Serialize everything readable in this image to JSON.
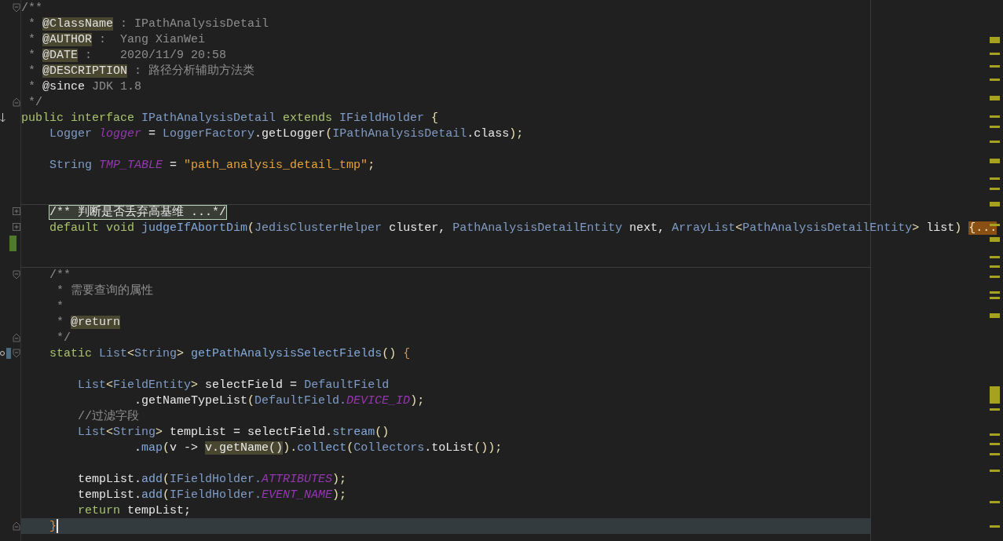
{
  "editor": {
    "lines": [
      {
        "gutter": [
          {
            "kind": "foldstart"
          }
        ],
        "tokens": [
          {
            "t": "/**",
            "kind": "comment"
          }
        ]
      },
      {
        "tokens": [
          {
            "t": " * ",
            "kind": "comment"
          },
          {
            "t": "@ClassName",
            "kind": "tag"
          },
          {
            "t": " : IPathAnalysisDetail",
            "kind": "comment"
          }
        ]
      },
      {
        "tokens": [
          {
            "t": " * ",
            "kind": "comment"
          },
          {
            "t": "@AUTHOR",
            "kind": "tag"
          },
          {
            "t": " :  Yang XianWei",
            "kind": "comment"
          }
        ]
      },
      {
        "tokens": [
          {
            "t": " * ",
            "kind": "comment"
          },
          {
            "t": "@DATE",
            "kind": "tag"
          },
          {
            "t": " :    2020/11/9 20:58",
            "kind": "comment"
          }
        ]
      },
      {
        "tokens": [
          {
            "t": " * ",
            "kind": "comment"
          },
          {
            "t": "@DESCRIPTION",
            "kind": "tag"
          },
          {
            "t": " : 路径分析辅助方法类",
            "kind": "comment"
          }
        ]
      },
      {
        "tokens": [
          {
            "t": " * ",
            "kind": "comment"
          },
          {
            "t": "@since",
            "kind": "doctag"
          },
          {
            "t": " JDK 1.8",
            "kind": "comment"
          }
        ]
      },
      {
        "gutter": [
          {
            "kind": "foldend"
          }
        ],
        "tokens": [
          {
            "t": " */",
            "kind": "comment"
          }
        ]
      },
      {
        "gutter": [
          {
            "kind": "implemented"
          }
        ],
        "tokens": [
          {
            "t": "public interface ",
            "kind": "keyword"
          },
          {
            "t": "IPathAnalysisDetail ",
            "kind": "type"
          },
          {
            "t": "extends ",
            "kind": "keyword"
          },
          {
            "t": "IFieldHolder ",
            "kind": "type"
          },
          {
            "t": "{",
            "kind": "punct"
          }
        ]
      },
      {
        "tokens": [
          {
            "t": "    Logger ",
            "kind": "type"
          },
          {
            "t": "logger",
            "kind": "field"
          },
          {
            "t": " = ",
            "kind": "plain"
          },
          {
            "t": "LoggerFactory",
            "kind": "type"
          },
          {
            "t": ".getLogger",
            "kind": "plain"
          },
          {
            "t": "(",
            "kind": "punct"
          },
          {
            "t": "IPathAnalysisDetail",
            "kind": "type"
          },
          {
            "t": ".class",
            "kind": "plain"
          },
          {
            "t": ");",
            "kind": "punct"
          }
        ]
      },
      {
        "kind": "blank"
      },
      {
        "tokens": [
          {
            "t": "    String ",
            "kind": "type"
          },
          {
            "t": "TMP_TABLE",
            "kind": "field"
          },
          {
            "t": " = ",
            "kind": "plain"
          },
          {
            "t": "\"path_analysis_detail_tmp\"",
            "kind": "string"
          },
          {
            "t": ";",
            "kind": "punct"
          }
        ]
      },
      {
        "kind": "blank"
      },
      {
        "kind": "blank"
      },
      {
        "separator": true,
        "gutter": [
          {
            "kind": "collapsed"
          }
        ],
        "tokens": [
          {
            "t": "    /** 判断是否丢弃高基维 ...*/",
            "kind": "foldedcomment"
          }
        ]
      },
      {
        "gutter": [
          {
            "kind": "collapsed"
          }
        ],
        "tokens": [
          {
            "t": "    default void ",
            "kind": "keyword"
          },
          {
            "t": "judgeIfAbortDim",
            "kind": "method"
          },
          {
            "t": "(",
            "kind": "punct"
          },
          {
            "t": "JedisClusterHelper ",
            "kind": "type"
          },
          {
            "t": "cluster, ",
            "kind": "plain"
          },
          {
            "t": "PathAnalysisDetailEntity ",
            "kind": "type"
          },
          {
            "t": "next, ",
            "kind": "plain"
          },
          {
            "t": "ArrayList",
            "kind": "type"
          },
          {
            "t": "<",
            "kind": "punct"
          },
          {
            "t": "PathAnalysisDetailEntity",
            "kind": "type"
          },
          {
            "t": ">",
            "kind": "punct"
          },
          {
            "t": " list",
            "kind": "plain"
          },
          {
            "t": ") ",
            "kind": "punct"
          },
          {
            "t": "{...",
            "kind": "foldedcode"
          }
        ]
      },
      {
        "changed": true
      },
      {
        "kind": "blank"
      },
      {
        "separator": true,
        "gutter": [
          {
            "kind": "foldstart"
          }
        ],
        "tokens": [
          {
            "t": "    /**",
            "kind": "comment"
          }
        ]
      },
      {
        "tokens": [
          {
            "t": "     * 需要查询的属性",
            "kind": "comment"
          }
        ]
      },
      {
        "tokens": [
          {
            "t": "     *",
            "kind": "comment"
          }
        ]
      },
      {
        "tokens": [
          {
            "t": "     * ",
            "kind": "comment"
          },
          {
            "t": "@return",
            "kind": "tag"
          }
        ]
      },
      {
        "gutter": [
          {
            "kind": "foldend"
          }
        ],
        "tokens": [
          {
            "t": "     */",
            "kind": "comment"
          }
        ]
      },
      {
        "gutter": [
          {
            "kind": "overridden"
          },
          {
            "kind": "foldstart"
          }
        ],
        "tokens": [
          {
            "t": "    static ",
            "kind": "keyword"
          },
          {
            "t": "List",
            "kind": "type"
          },
          {
            "t": "<",
            "kind": "punct"
          },
          {
            "t": "String",
            "kind": "type"
          },
          {
            "t": "> ",
            "kind": "punct"
          },
          {
            "t": "getPathAnalysisSelectFields",
            "kind": "method"
          },
          {
            "t": "() ",
            "kind": "punct"
          },
          {
            "t": "{",
            "kind": "brace"
          }
        ]
      },
      {
        "kind": "blank"
      },
      {
        "tokens": [
          {
            "t": "        List",
            "kind": "type"
          },
          {
            "t": "<",
            "kind": "punct"
          },
          {
            "t": "FieldEntity",
            "kind": "type"
          },
          {
            "t": "> ",
            "kind": "punct"
          },
          {
            "t": "selectField = ",
            "kind": "plain"
          },
          {
            "t": "DefaultField",
            "kind": "type"
          }
        ]
      },
      {
        "tokens": [
          {
            "t": "                .getNameTypeList",
            "kind": "plain"
          },
          {
            "t": "(",
            "kind": "punct"
          },
          {
            "t": "DefaultField.",
            "kind": "type"
          },
          {
            "t": "DEVICE_ID",
            "kind": "field"
          },
          {
            "t": ");",
            "kind": "punct"
          }
        ]
      },
      {
        "tokens": [
          {
            "t": "        //过滤字段",
            "kind": "comment"
          }
        ]
      },
      {
        "tokens": [
          {
            "t": "        List",
            "kind": "type"
          },
          {
            "t": "<",
            "kind": "punct"
          },
          {
            "t": "String",
            "kind": "type"
          },
          {
            "t": "> ",
            "kind": "punct"
          },
          {
            "t": "tempList = selectField.",
            "kind": "plain"
          },
          {
            "t": "stream",
            "kind": "method"
          },
          {
            "t": "()",
            "kind": "punct"
          }
        ]
      },
      {
        "tokens": [
          {
            "t": "                .",
            "kind": "plain"
          },
          {
            "t": "map",
            "kind": "method"
          },
          {
            "t": "(",
            "kind": "punct"
          },
          {
            "t": "v -> ",
            "kind": "plain"
          },
          {
            "t": "v.getName()",
            "kind": "highlight"
          },
          {
            "t": ").",
            "kind": "punct"
          },
          {
            "t": "collect",
            "kind": "method"
          },
          {
            "t": "(",
            "kind": "punct"
          },
          {
            "t": "Collectors",
            "kind": "type"
          },
          {
            "t": ".toList",
            "kind": "plain"
          },
          {
            "t": "());",
            "kind": "punct"
          }
        ]
      },
      {
        "kind": "blank"
      },
      {
        "tokens": [
          {
            "t": "        tempList.",
            "kind": "plain"
          },
          {
            "t": "add",
            "kind": "method"
          },
          {
            "t": "(",
            "kind": "punct"
          },
          {
            "t": "IFieldHolder.",
            "kind": "type"
          },
          {
            "t": "ATTRIBUTES",
            "kind": "field"
          },
          {
            "t": ");",
            "kind": "punct"
          }
        ]
      },
      {
        "tokens": [
          {
            "t": "        tempList.",
            "kind": "plain"
          },
          {
            "t": "add",
            "kind": "method"
          },
          {
            "t": "(",
            "kind": "punct"
          },
          {
            "t": "IFieldHolder.",
            "kind": "type"
          },
          {
            "t": "EVENT_NAME",
            "kind": "field"
          },
          {
            "t": ");",
            "kind": "punct"
          }
        ]
      },
      {
        "tokens": [
          {
            "t": "        return ",
            "kind": "keyword"
          },
          {
            "t": "tempList;",
            "kind": "plain"
          }
        ]
      },
      {
        "current": true,
        "gutter": [
          {
            "kind": "foldend"
          }
        ],
        "tokens": [
          {
            "t": "    }",
            "kind": "brace"
          }
        ]
      }
    ]
  }
}
